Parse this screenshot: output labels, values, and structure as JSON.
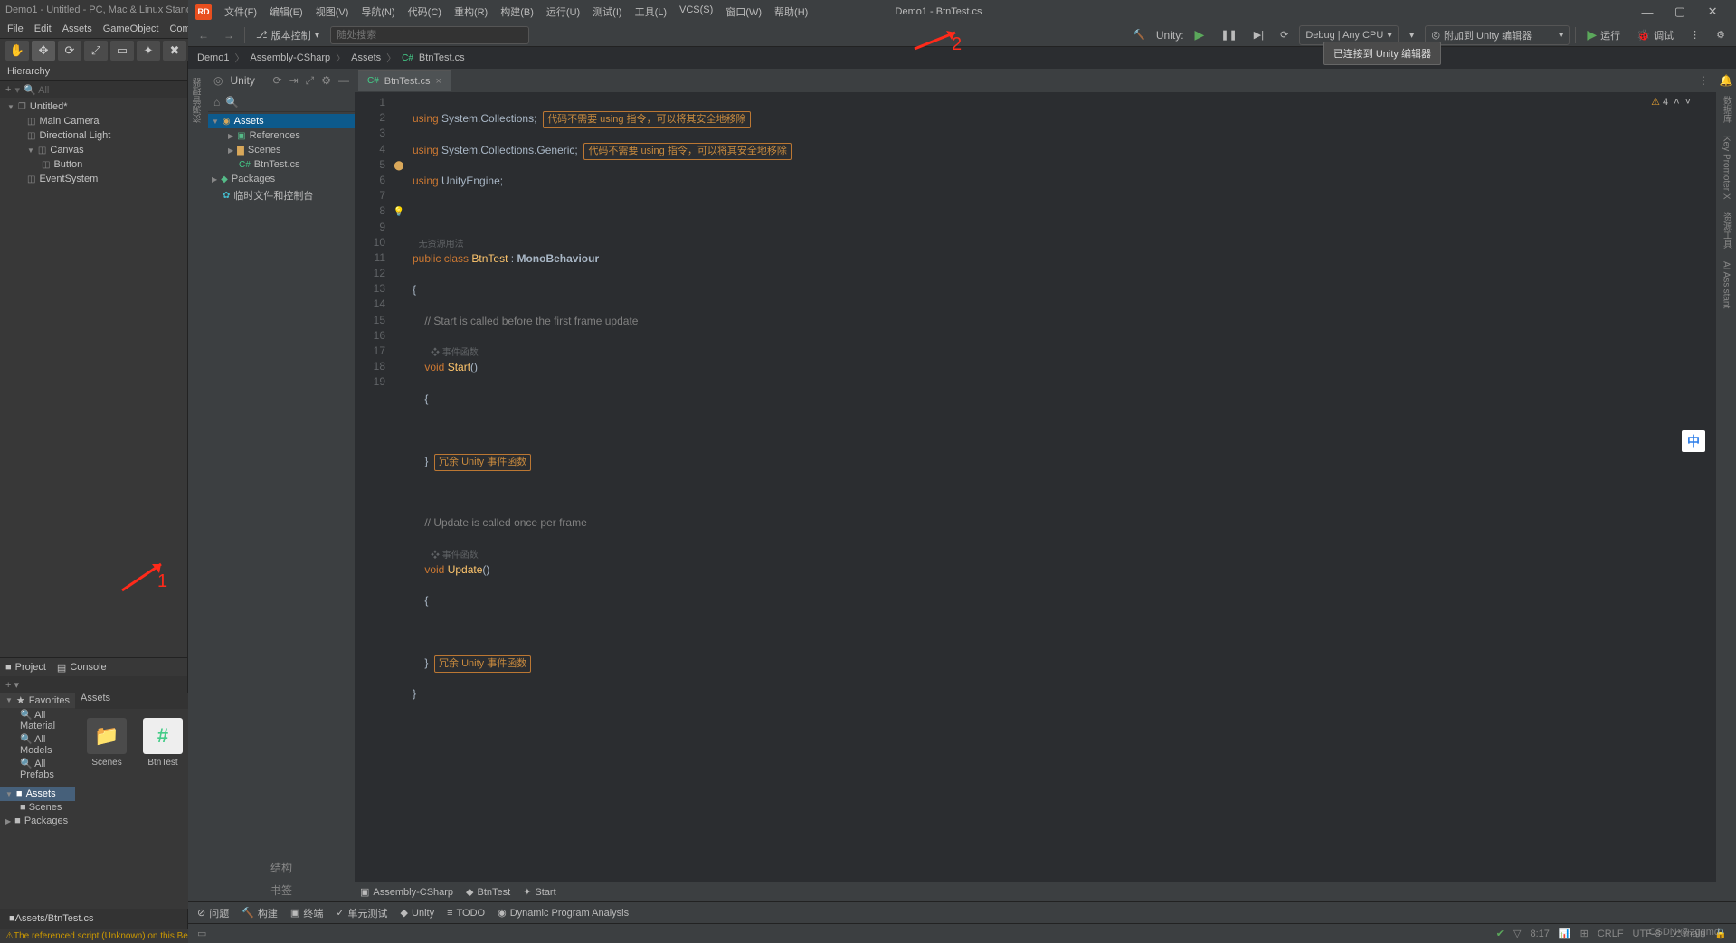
{
  "unity": {
    "title": "Demo1 - Untitled - PC, Mac & Linux Stand",
    "menu": [
      "File",
      "Edit",
      "Assets",
      "GameObject",
      "Compone"
    ],
    "hierarchy_title": "Hierarchy",
    "hierarchy_add": "+",
    "hierarchy_search_ph": "All",
    "scene": "Untitled*",
    "scene_items": [
      "Main Camera",
      "Directional Light",
      "Canvas",
      "Button",
      "EventSystem"
    ],
    "tabs": {
      "project": "Project",
      "console": "Console"
    },
    "favorites": "Favorites",
    "fav_items": [
      "All Material",
      "All Models",
      "All Prefabs"
    ],
    "assets": "Assets",
    "asset_children": [
      "Scenes",
      "Packages"
    ],
    "grid_assets_label": "Assets",
    "grid": [
      {
        "name": "Scenes",
        "type": "folder"
      },
      {
        "name": "BtnTest",
        "type": "cs"
      }
    ],
    "status_path": "Assets/BtnTest.cs",
    "status_warn": "The referenced script (Unknown) on this Beh"
  },
  "rider": {
    "title_menu": [
      "文件(F)",
      "编辑(E)",
      "视图(V)",
      "导航(N)",
      "代码(C)",
      "重构(R)",
      "构建(B)",
      "运行(U)",
      "测试(I)",
      "工具(L)",
      "VCS(S)",
      "窗口(W)",
      "帮助(H)"
    ],
    "title_project": "Demo1 - BtnTest.cs",
    "vc_label": "版本控制",
    "search_ph": "随处搜索",
    "unity_label": "Unity:",
    "config": "Debug | Any CPU",
    "attach": "附加到 Unity 编辑器",
    "run_label": "运行",
    "debug_label": "调试",
    "tooltip": "已连接到 Unity 编辑器",
    "breadcrumb": [
      "Demo1",
      "Assembly-CSharp",
      "Assets",
      "BtnTest.cs"
    ],
    "left_tool": "资源管理器",
    "explorer": {
      "title": "Unity",
      "root": "Assets",
      "items": [
        {
          "l": 1,
          "icon": "nuget",
          "label": "References"
        },
        {
          "l": 1,
          "icon": "fold",
          "label": "Scenes"
        },
        {
          "l": 1,
          "icon": "cs",
          "label": "BtnTest.cs"
        },
        {
          "l": 0,
          "icon": "nuget",
          "label": "Packages"
        },
        {
          "l": 0,
          "icon": "gear",
          "label": "临时文件和控制台"
        }
      ]
    },
    "tab": "BtnTest.cs",
    "inspection": {
      "warn_count": "4"
    },
    "code": {
      "lines": [
        1,
        2,
        3,
        4,
        5,
        6,
        7,
        8,
        9,
        10,
        11,
        12,
        13,
        14,
        15,
        16,
        17,
        18,
        19
      ],
      "l1_using": "using",
      "l1_ns": "System.Collections;",
      "l1_hint": "代码不需要 using 指令，可以将其安全地移除",
      "l2_ns": "System.Collections.Generic;",
      "l2_hint": "代码不需要 using 指令，可以将其安全地移除",
      "l3_ns": "UnityEngine;",
      "meta_noref": "无资源用法",
      "l5_public": "public",
      "l5_class": "class",
      "l5_name": "BtnTest",
      "l5_colon": ":",
      "l5_base": "MonoBehaviour",
      "l7_com": "// Start is called before the first frame update",
      "meta_evt": "事件函数",
      "l8_void": "void",
      "l8_name": "Start",
      "l8_par": "()",
      "l11_hint": "冗余 Unity 事件函数",
      "l13_com": "// Update is called once per frame",
      "l14_name": "Update",
      "l14_par": "()",
      "l17_hint": "冗余 Unity 事件函数"
    },
    "bottom_breadcrumb": [
      "Assembly-CSharp",
      "BtnTest",
      "Start"
    ],
    "bottom_tabs": [
      "问题",
      "构建",
      "终端",
      "单元测试",
      "Unity",
      "TODO",
      "Dynamic Program Analysis"
    ],
    "left_bottom_tabs": [
      "结构",
      "书签"
    ],
    "right_tools": [
      "通知",
      "数据库",
      "Key Promoter X",
      "资源工具",
      "AI Assistant"
    ],
    "status": {
      "time": "8:17",
      "crlf": "CRLF",
      "enc": "UTF-8",
      "git": "main"
    }
  },
  "annotations": {
    "one": "1",
    "two": "2"
  },
  "ime": "中",
  "watermark": "CSDN @zggmd"
}
